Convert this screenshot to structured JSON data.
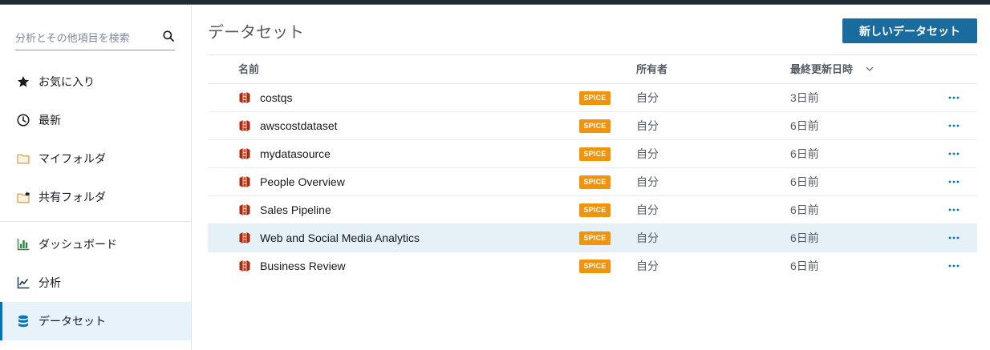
{
  "colors": {
    "top_bar": "#1e2a35",
    "accent": "#0073bb",
    "primary_button": "#1a6b9e",
    "spice_badge": "#f0930d",
    "selected_bg": "#e7f2fa",
    "highlight_row_bg": "#e5f0f7",
    "dashboard_icon": "#2e8540",
    "dataset_row_icon": "#a62c13"
  },
  "sidebar": {
    "search": {
      "placeholder": "分析とその他項目を検索",
      "value": "",
      "icon": "search-icon"
    },
    "items": [
      {
        "label": "お気に入り",
        "icon": "star-icon"
      },
      {
        "label": "最新",
        "icon": "clock-icon"
      },
      {
        "label": "マイフォルダ",
        "icon": "folder-icon"
      },
      {
        "label": "共有フォルダ",
        "icon": "shared-folder-icon"
      },
      {
        "label": "ダッシュボード",
        "icon": "dashboard-icon"
      },
      {
        "label": "分析",
        "icon": "analysis-icon"
      },
      {
        "label": "データセット",
        "icon": "dataset-icon",
        "selected": true
      }
    ]
  },
  "main": {
    "title": "データセット",
    "new_dataset_button": {
      "label": "新しいデータセット"
    },
    "table": {
      "columns": {
        "name": {
          "label": "名前"
        },
        "owner": {
          "label": "所有者"
        },
        "updated": {
          "label": "最終更新日時",
          "sort_icon": "chevron-down-icon"
        }
      },
      "row_icon": "dataset-icon",
      "row_actions_icon": "more-icon",
      "rows": [
        {
          "name": "costqs",
          "badge": "SPICE",
          "owner": "自分",
          "updated": "3日前"
        },
        {
          "name": "awscostdataset",
          "badge": "SPICE",
          "owner": "自分",
          "updated": "6日前"
        },
        {
          "name": "mydatasource",
          "badge": "SPICE",
          "owner": "自分",
          "updated": "6日前"
        },
        {
          "name": "People Overview",
          "badge": "SPICE",
          "owner": "自分",
          "updated": "6日前"
        },
        {
          "name": "Sales Pipeline",
          "badge": "SPICE",
          "owner": "自分",
          "updated": "6日前"
        },
        {
          "name": "Web and Social Media Analytics",
          "badge": "SPICE",
          "owner": "自分",
          "updated": "6日前",
          "highlighted": true
        },
        {
          "name": "Business Review",
          "badge": "SPICE",
          "owner": "自分",
          "updated": "6日前"
        }
      ]
    }
  }
}
